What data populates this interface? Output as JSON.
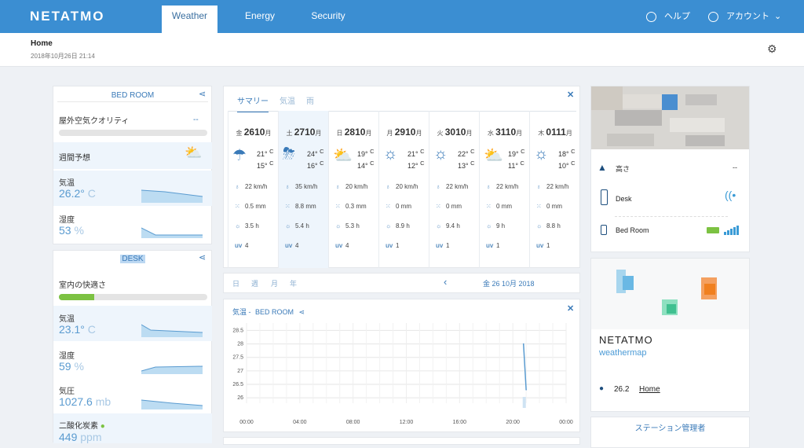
{
  "app": {
    "logo": "NETATMO",
    "tabs": [
      "Weather",
      "Energy",
      "Security"
    ],
    "help": "ヘルプ",
    "account": "アカウント"
  },
  "subheader": {
    "title": "Home",
    "datetime": "2018年10月26日 21:14"
  },
  "left": {
    "bedroom": {
      "title": "BED ROOM",
      "air_label": "屋外空気クオリティ",
      "air_value": "--",
      "forecast_label": "週間予想",
      "temp_label": "気温",
      "temp_value": "26.2°",
      "temp_unit": "C",
      "hum_label": "湿度",
      "hum_value": "53",
      "hum_unit": "%"
    },
    "desk": {
      "title": "DESK",
      "comfort_label": "室内の快適さ",
      "comfort_level": 0.24,
      "temp_label": "気温",
      "temp_value": "23.1°",
      "temp_unit": "C",
      "hum_label": "湿度",
      "hum_value": "59",
      "hum_unit": "%",
      "press_label": "気圧",
      "press_value": "1027.6",
      "press_unit": "mb",
      "co2_label": "二酸化炭素",
      "co2_value": "449",
      "co2_unit": "ppm"
    }
  },
  "forecast": {
    "tabs": [
      "サマリー",
      "気温",
      "雨"
    ],
    "days": [
      {
        "dow": "金",
        "day": "26",
        "mon": "10",
        "m": "月",
        "hi": "21°",
        "lo": "15°",
        "wind": "22 km/h",
        "rain": "0.5 mm",
        "sun": "3.5 h",
        "uv": "4",
        "icon": "☂"
      },
      {
        "dow": "土",
        "day": "27",
        "mon": "10",
        "m": "月",
        "hi": "24°",
        "lo": "16°",
        "wind": "35 km/h",
        "rain": "8.8 mm",
        "sun": "5.4 h",
        "uv": "4",
        "icon": "⛈"
      },
      {
        "dow": "日",
        "day": "28",
        "mon": "10",
        "m": "月",
        "hi": "19°",
        "lo": "14°",
        "wind": "20 km/h",
        "rain": "0.3 mm",
        "sun": "5.3 h",
        "uv": "4",
        "icon": "⛅"
      },
      {
        "dow": "月",
        "day": "29",
        "mon": "10",
        "m": "月",
        "hi": "21°",
        "lo": "12°",
        "wind": "20 km/h",
        "rain": "0 mm",
        "sun": "8.9 h",
        "uv": "1",
        "icon": "☼"
      },
      {
        "dow": "火",
        "day": "30",
        "mon": "10",
        "m": "月",
        "hi": "22°",
        "lo": "13°",
        "wind": "22 km/h",
        "rain": "0 mm",
        "sun": "9.4 h",
        "uv": "1",
        "icon": "☼"
      },
      {
        "dow": "水",
        "day": "31",
        "mon": "10",
        "m": "月",
        "hi": "19°",
        "lo": "11°",
        "wind": "22 km/h",
        "rain": "0 mm",
        "sun": "9 h",
        "uv": "1",
        "icon": "⛅"
      },
      {
        "dow": "木",
        "day": "01",
        "mon": "11",
        "m": "月",
        "hi": "18°",
        "lo": "10°",
        "wind": "22 km/h",
        "rain": "0 mm",
        "sun": "8.8 h",
        "uv": "1",
        "icon": "☼"
      }
    ],
    "c": "C",
    "uv_label": "uv"
  },
  "datenav": {
    "periods": [
      "日",
      "週",
      "月",
      "年"
    ],
    "current": "金 26 10月 2018"
  },
  "chart_panel": {
    "title_prefix": "気温 -",
    "title_station": "BED ROOM"
  },
  "chart_data": {
    "type": "line",
    "x_ticks": [
      "00:00",
      "04:00",
      "08:00",
      "12:00",
      "16:00",
      "20:00",
      "00:00"
    ],
    "y_ticks": [
      "28.5",
      "28",
      "27.5",
      "27",
      "26.5",
      "26"
    ],
    "ylim": [
      25.8,
      28.6
    ],
    "series": [
      {
        "x_hours": [
          20.8,
          21.0
        ],
        "values": [
          28.0,
          26.3
        ]
      }
    ],
    "line_color": "#5a9bd0"
  },
  "right": {
    "altitude_label": "高さ",
    "altitude_value": "--",
    "modules": [
      {
        "name": "Desk"
      },
      {
        "name": "Bed Room"
      }
    ],
    "map_brand": "NETATMO",
    "map_sub": "weathermap",
    "count": "26.2",
    "home_link": "Home",
    "station_manager": "ステーション管理者"
  }
}
